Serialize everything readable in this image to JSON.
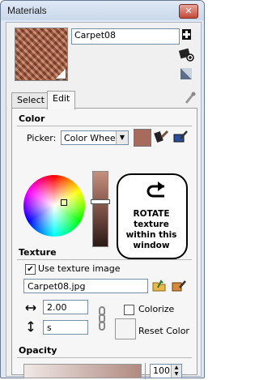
{
  "window": {
    "title": "Materials",
    "close_glyph": "✕"
  },
  "top": {
    "material_name": "Carpet08",
    "icons": [
      "create-material-icon",
      "sample-paint-icon",
      "default-material-icon"
    ]
  },
  "tabs": [
    {
      "label": "Select"
    },
    {
      "label": "Edit"
    }
  ],
  "color": {
    "section_label": "Color",
    "picker_label": "Picker:",
    "picker_value": "Color Wheel",
    "current_color": "#a86a5c",
    "annotation": {
      "line1": "ROTATE",
      "line2": "texture",
      "line3": "within this",
      "line4": "window"
    }
  },
  "texture": {
    "section_label": "Texture",
    "use_texture_label": "Use texture image",
    "use_texture_checked": "✔",
    "filename": "Carpet08.jpg",
    "width_value": "2.00",
    "height_value": "s",
    "colorize_label": "Colorize",
    "reset_label": "Reset Color"
  },
  "opacity": {
    "section_label": "Opacity",
    "value": "100"
  }
}
